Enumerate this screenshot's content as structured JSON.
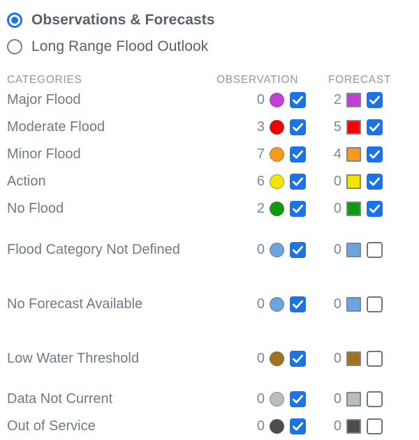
{
  "mode_selector": {
    "name": "display-mode",
    "options": [
      {
        "label": "Observations & Forecasts",
        "selected": true
      },
      {
        "label": "Long Range Flood Outlook",
        "selected": false
      }
    ]
  },
  "table": {
    "headers": {
      "categories": "CATEGORIES",
      "observation": "OBSERVATION",
      "forecast": "FORECAST"
    },
    "rows": [
      {
        "label": "Major Flood",
        "color": "#c23ed6",
        "observation": {
          "count": "0",
          "checked": true
        },
        "forecast": {
          "count": "2",
          "checked": true
        }
      },
      {
        "label": "Moderate Flood",
        "color": "#f50000",
        "observation": {
          "count": "3",
          "checked": true
        },
        "forecast": {
          "count": "5",
          "checked": true
        }
      },
      {
        "label": "Minor Flood",
        "color": "#f79a1e",
        "observation": {
          "count": "7",
          "checked": true
        },
        "forecast": {
          "count": "4",
          "checked": true
        }
      },
      {
        "label": "Action",
        "color": "#f2e500",
        "observation": {
          "count": "6",
          "checked": true
        },
        "forecast": {
          "count": "0",
          "checked": true
        }
      },
      {
        "label": "No Flood",
        "color": "#0c9c0c",
        "observation": {
          "count": "2",
          "checked": true
        },
        "forecast": {
          "count": "0",
          "checked": true
        }
      },
      {
        "label": "Flood Category Not Defined",
        "color": "#6aa6dd",
        "observation": {
          "count": "0",
          "checked": true
        },
        "forecast": {
          "count": "0",
          "checked": false
        }
      },
      {
        "label": "No Forecast Available",
        "color": "#6aa6dd",
        "observation": {
          "count": "0",
          "checked": true
        },
        "forecast": {
          "count": "0",
          "checked": false
        }
      },
      {
        "label": "Low Water Threshold",
        "color": "#a0721f",
        "observation": {
          "count": "0",
          "checked": true
        },
        "forecast": {
          "count": "0",
          "checked": false
        }
      },
      {
        "label": "Data Not Current",
        "color": "#b7c0b7",
        "observation": {
          "count": "0",
          "checked": true
        },
        "forecast": {
          "count": "0",
          "checked": false
        }
      },
      {
        "label": "Out of Service",
        "color": "#4d4d4d",
        "observation": {
          "count": "0",
          "checked": true
        },
        "forecast": {
          "count": "0",
          "checked": false
        }
      }
    ]
  },
  "colors": {
    "accent": "#1a73e8",
    "text": "#6e7b85",
    "header_text": "#8b98a3",
    "radio_label": "#57606a"
  }
}
